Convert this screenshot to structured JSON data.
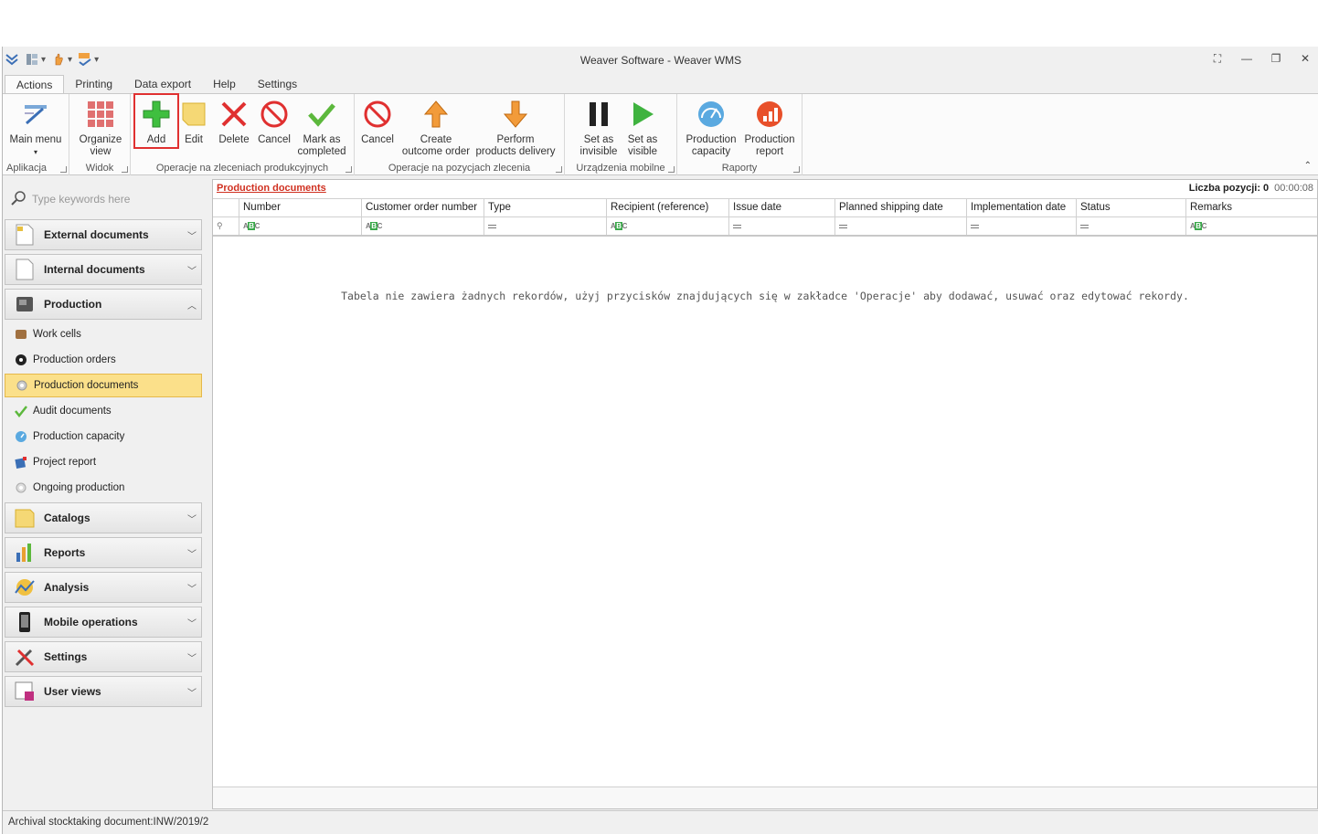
{
  "window": {
    "title": "Weaver Software - Weaver WMS"
  },
  "ribbon_tabs": [
    "Actions",
    "Printing",
    "Data export",
    "Help",
    "Settings"
  ],
  "ribbon": {
    "groups": {
      "app": "Aplikacja",
      "view": "Widok",
      "orders": "Operacje na zleceniach produkcyjnych",
      "positions": "Operacje na pozycjach zlecenia",
      "mobile": "Urządzenia mobilne",
      "reports": "Raporty"
    },
    "buttons": {
      "main_menu": "Main menu",
      "organize_view": "Organize view",
      "add": "Add",
      "edit": "Edit",
      "delete": "Delete",
      "cancel": "Cancel",
      "mark_completed": "Mark as completed",
      "cancel2": "Cancel",
      "create_outcome": "Create outcome order",
      "perform_delivery": "Perform products delivery",
      "set_invisible": "Set as invisible",
      "set_visible": "Set as visible",
      "production_capacity": "Production capacity",
      "production_report": "Production report"
    }
  },
  "sidebar": {
    "search_placeholder": "Type keywords here",
    "groups": {
      "external": "External documents",
      "internal": "Internal documents",
      "production": "Production",
      "catalogs": "Catalogs",
      "reports": "Reports",
      "analysis": "Analysis",
      "mobile": "Mobile operations",
      "settings": "Settings",
      "user_views": "User views"
    },
    "production_items": [
      "Work cells",
      "Production orders",
      "Production documents",
      "Audit documents",
      "Production capacity",
      "Project report",
      "Ongoing production"
    ],
    "selected_item": "Production documents"
  },
  "main": {
    "title": "Production documents",
    "count_label": "Liczba pozycji: 0",
    "elapsed": "00:00:08",
    "columns": [
      "Number",
      "Customer order number",
      "Type",
      "Recipient (reference)",
      "Issue date",
      "Planned shipping date",
      "Implementation date",
      "Status",
      "Remarks"
    ],
    "empty_message": "Tabela nie zawiera żadnych rekordów, użyj przycisków znajdujących się w zakładce 'Operacje' aby dodawać, usuwać oraz edytować rekordy."
  },
  "statusbar": {
    "text": "Archival stocktaking document:INW/2019/2"
  },
  "colors": {
    "selected_bg": "#fbe08a",
    "link_red": "#d03020",
    "highlight_box": "#e03030"
  }
}
